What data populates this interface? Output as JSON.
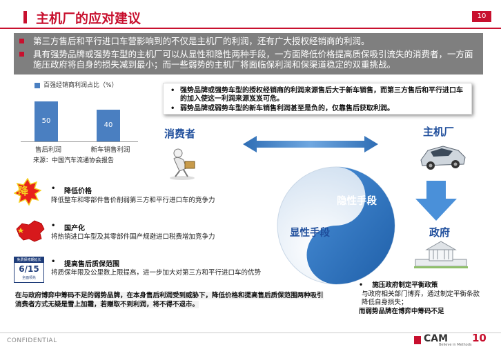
{
  "header": {
    "title": "主机厂的应对建议",
    "page_number": "10"
  },
  "banner": {
    "bullets": [
      "第三方售后和平行进口车营影响到的不仅是主机厂的利润，还有广大授权经销商的利润。",
      "具有强势品牌或强势车型的主机厂可以从显性和隐性两种手段，一方面降低价格提高质保吸引流失的消费者，一方面施压政府将自身的损失减到最小；而一些弱势的主机厂将面临保利润和保渠道稳定的双重挑战。"
    ]
  },
  "chart_data": {
    "type": "bar",
    "title": "",
    "legend": [
      "百强经销商利润占比（%）"
    ],
    "categories": [
      "售后利润",
      "新车销售利润"
    ],
    "values": [
      50,
      40
    ],
    "ylim": [
      0,
      65
    ],
    "source": "来源：中国汽车流通协会报告"
  },
  "notes": {
    "items": [
      "强势品牌或强势车型的授权经销商的利润来源售后大于新车销售，而第三方售后和平行进口车的加入使这一利润来源岌岌可危。",
      "弱势品牌或弱势车型的新车销售利润甚至是负的，仅靠售后获取利润。"
    ]
  },
  "diagram": {
    "consumer": "消费者",
    "oem": "主机厂",
    "government": "政府",
    "implicit": "隐性手段",
    "explicit": "显性手段",
    "colors": {
      "blue": "#2e6db4",
      "light_blue": "#4a90d9",
      "red": "#c8102e"
    }
  },
  "measures": [
    {
      "icon": "price-drop-icon",
      "badge": "降",
      "title": "降低价格",
      "desc": "降低整车和零部件售价削弱第三方和平行进口车的竞争力"
    },
    {
      "icon": "china-map-icon",
      "title": "国产化",
      "desc": "将热销进口车型及其零部件国产规避进口税费增加竞争力"
    },
    {
      "icon": "warranty-icon",
      "badge_top": "免费保修期延长",
      "badge_main": "6/15",
      "badge_bottom": "全面领先",
      "title": "提高售后质保范围",
      "desc": "将质保年限及公里数上限提高，进一步加大对第三方和平行进口车的优势"
    }
  ],
  "conclusion": "在与政府博弈中筹码不足的弱势品牌，在本身售后利润受到威胁下，降低价格和提高售后质保范围两种吸引消费者方式无疑是雪上加霜，若赚取不到利润，将不得不退市。",
  "right_note": {
    "title": "施压政府制定平衡政策",
    "body": "与政府相关部门博弈，通过制定平衡条款降低自身损失；",
    "emphasis": "而弱势品牌在博弈中筹码不足"
  },
  "footer": {
    "confidential": "CONFIDENTIAL",
    "brand": "CAM",
    "brand_sub": "Believe in Methods",
    "brand_num": "10"
  }
}
